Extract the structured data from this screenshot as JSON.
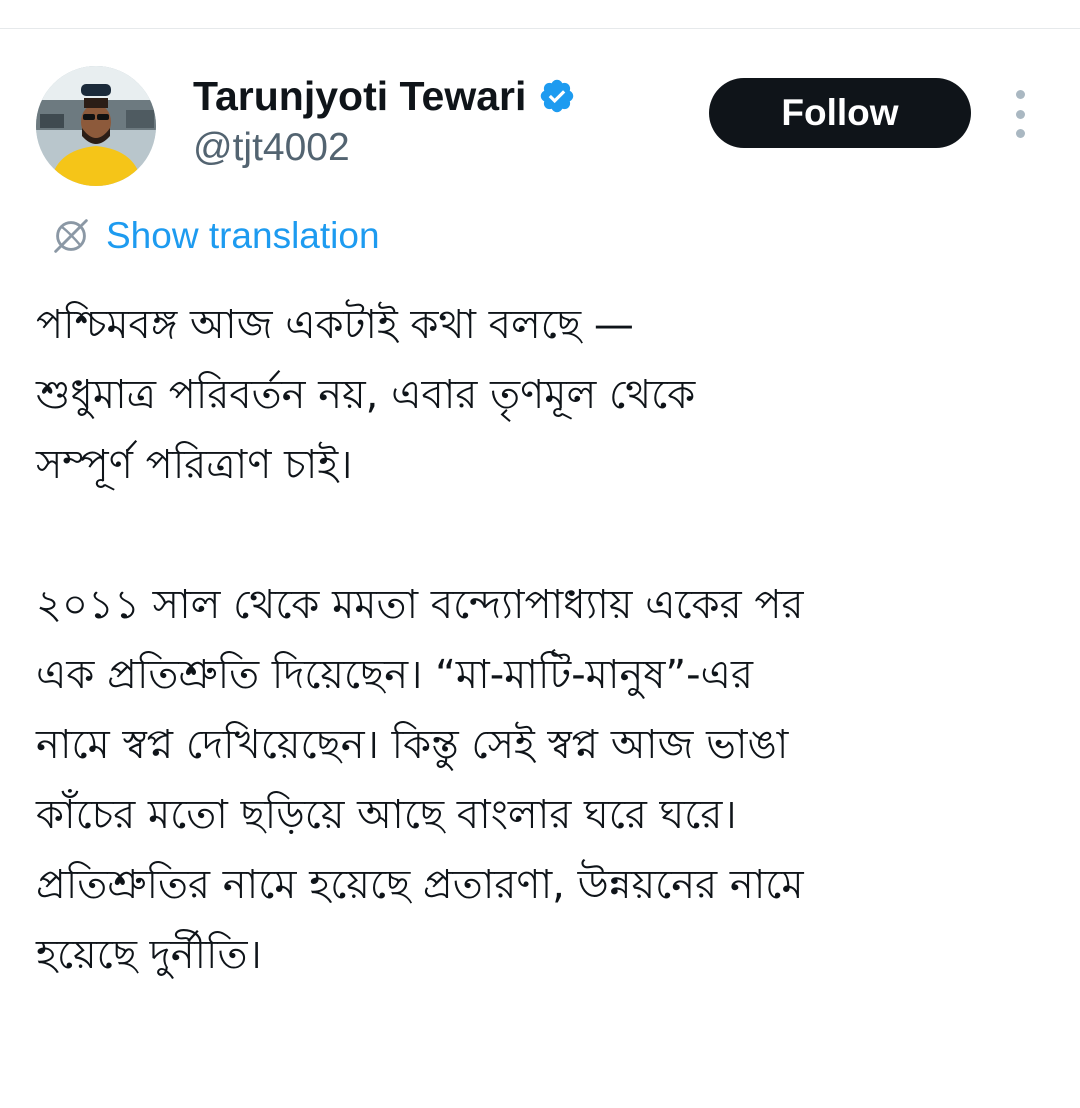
{
  "author": {
    "display_name": "Tarunjyoti Tewari",
    "handle": "@tjt4002",
    "verified": true,
    "avatar_icon": "person-avatar"
  },
  "actions": {
    "follow_label": "Follow",
    "more_icon": "more-vertical-icon"
  },
  "translation": {
    "icon": "globe-icon",
    "label": "Show translation"
  },
  "tweet": {
    "paragraphs": [
      {
        "lines": [
          "পশ্চিমবঙ্গ আজ একটাই কথা বলছে —",
          "শুধুমাত্র পরিবর্তন নয়, এবার তৃণমূল থেকে",
          "সম্পূর্ণ পরিত্রাণ চাই।"
        ]
      },
      {
        "lines": [
          "২০১১ সাল থেকে মমতা বন্দ্যোপাধ্যায় একের পর",
          "এক প্রতিশ্রুতি দিয়েছেন। “মা-মাটি-মানুষ”-এর",
          "নামে স্বপ্ন দেখিয়েছেন। কিন্তু সেই স্বপ্ন আজ ভাঙা",
          "কাঁচের মতো ছড়িয়ে আছে বাংলার ঘরে ঘরে।",
          "প্রতিশ্রুতির নামে হয়েছে প্রতারণা, উন্নয়নের নামে",
          "হয়েছে দুর্নীতি।"
        ]
      }
    ]
  },
  "colors": {
    "text": "#0f1419",
    "secondary_text": "#536471",
    "link": "#1d9bf0",
    "verified_badge": "#1d9bf0",
    "follow_button_bg": "#0f1419",
    "follow_button_text": "#ffffff"
  }
}
